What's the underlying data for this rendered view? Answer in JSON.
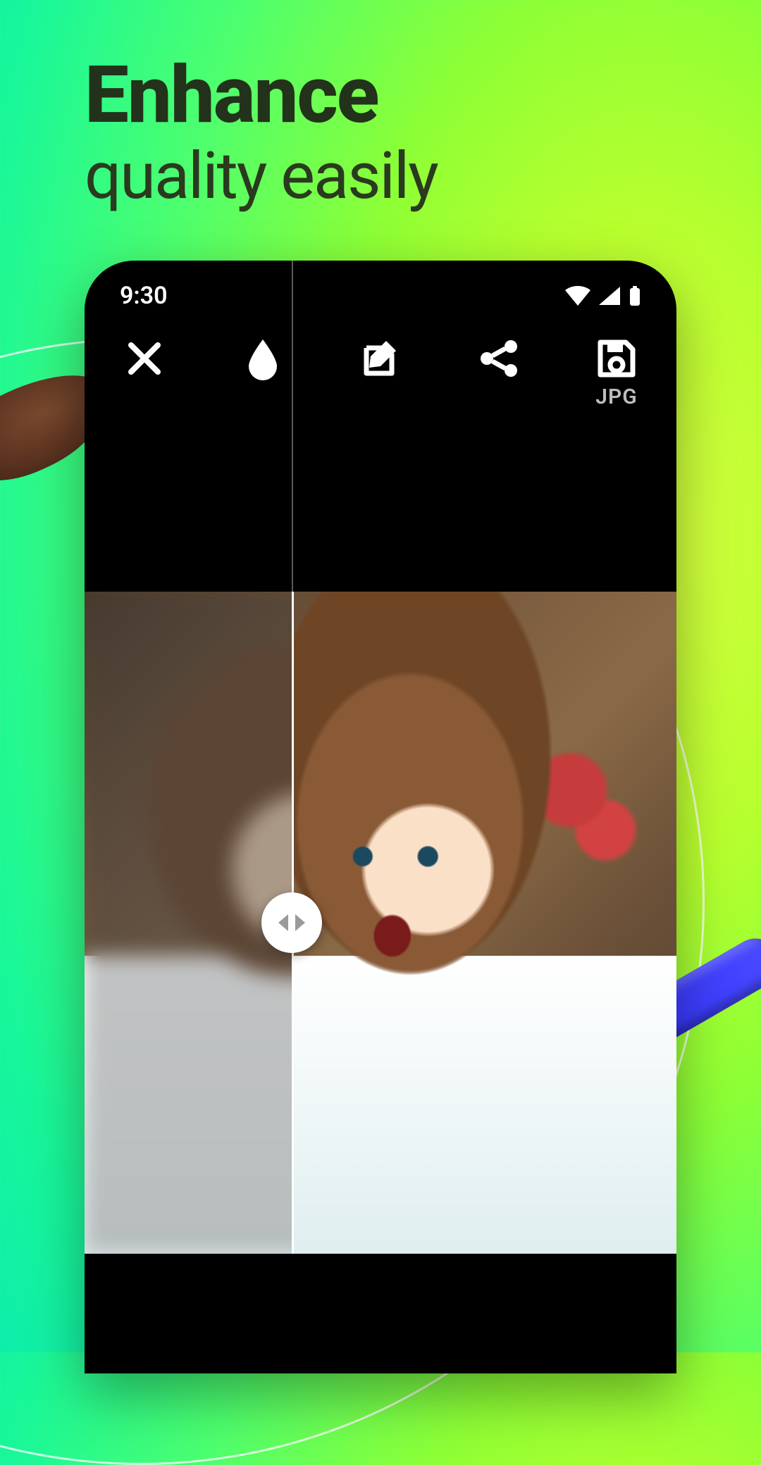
{
  "hero": {
    "title": "Enhance",
    "subtitle": "quality easily"
  },
  "statusbar": {
    "time": "9:30"
  },
  "toolbar": {
    "close": {
      "name": "close"
    },
    "blur": {
      "name": "blur"
    },
    "edit": {
      "name": "edit"
    },
    "share": {
      "name": "share"
    },
    "save": {
      "name": "save",
      "format_label": "JPG"
    }
  },
  "compare": {
    "split_percent": 35
  }
}
